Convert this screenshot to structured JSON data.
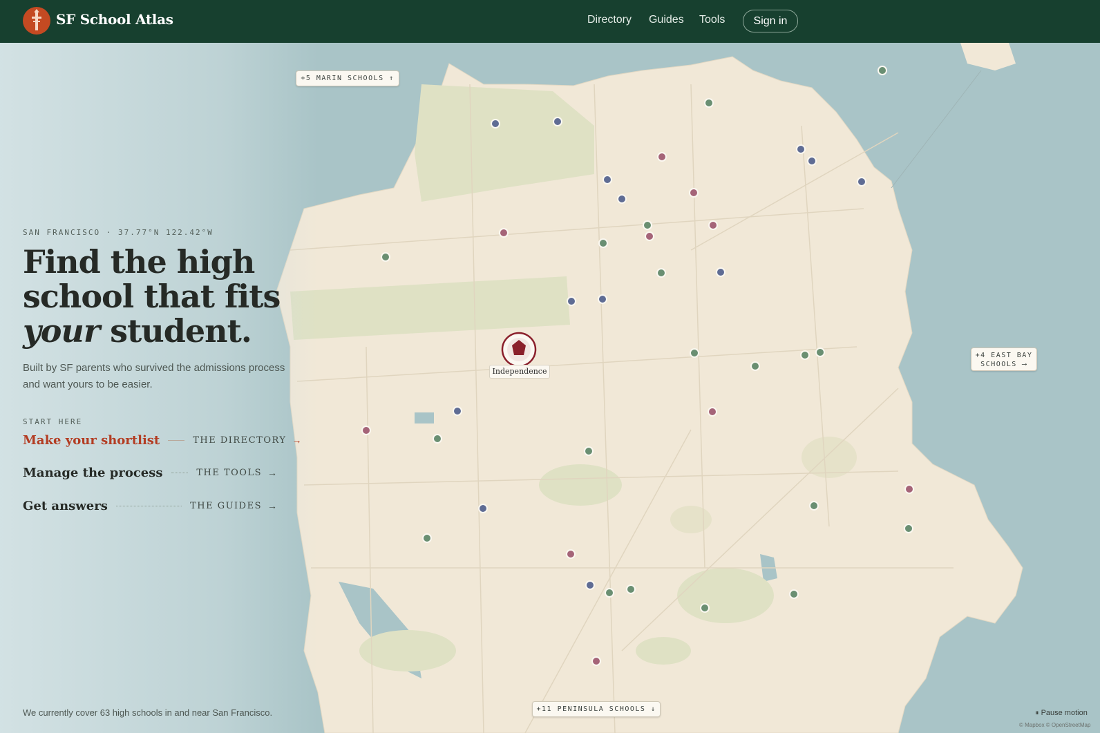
{
  "header": {
    "brand": "SF School Atlas",
    "nav": [
      "Directory",
      "Guides",
      "Tools"
    ],
    "sign_in": "Sign in"
  },
  "hero": {
    "coords": "SAN FRANCISCO · 37.77°N 122.42°W",
    "title_line1": "Find the high",
    "title_line2": "school that fits",
    "title_line3_italic": "your",
    "title_line3_rest": " student.",
    "subtitle": "Built by SF parents who survived the admissions process and want yours to be easier."
  },
  "start": {
    "label": "START HERE",
    "ctas": [
      {
        "title": "Make your shortlist",
        "dest": "THE DIRECTORY",
        "arrow": "→"
      },
      {
        "title": "Manage the process",
        "dest": "THE TOOLS",
        "arrow": "→"
      },
      {
        "title": "Get answers",
        "dest": "THE GUIDES",
        "arrow": "→"
      }
    ]
  },
  "coverage": "We currently cover 63 high schools in and near San Francisco.",
  "map": {
    "marin_pill": "+5 MARIN SCHOOLS ↑",
    "eastbay_pill_line1": "+4 EAST BAY",
    "eastbay_pill_line2": "SCHOOLS ⟶",
    "peninsula_pill": "+11 PENINSULA SCHOOLS ↓",
    "selected_school": "Independence",
    "pause": "Pause motion",
    "credit": "© Mapbox © OpenStreetMap",
    "colors": {
      "land": "#f1e8d7",
      "water": "#a9c4c7",
      "park": "#dfe1c4",
      "dot_blue": "#5f6c94",
      "dot_pink": "#a56478",
      "dot_green": "#6a8f72",
      "brand": "#17402f",
      "accent": "#c44a22"
    }
  }
}
